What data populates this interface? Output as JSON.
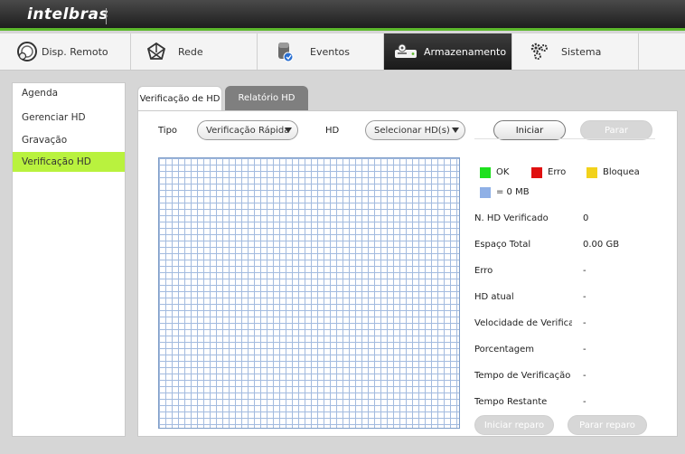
{
  "app": {
    "logo": "intelbras"
  },
  "main_tabs": [
    {
      "label": "Disp. Remoto",
      "icon": "remote-device-icon"
    },
    {
      "label": "Rede",
      "icon": "network-icon"
    },
    {
      "label": "Eventos",
      "icon": "events-icon"
    },
    {
      "label": "Armazenamento",
      "icon": "storage-icon",
      "active": true
    },
    {
      "label": "Sistema",
      "icon": "system-gears-icon"
    }
  ],
  "sidebar": {
    "items": [
      {
        "label": "Agenda"
      },
      {
        "label": "Gerenciar HD"
      },
      {
        "label": "Gravação"
      },
      {
        "label": "Verificação HD",
        "active": true
      }
    ]
  },
  "subtabs": [
    {
      "label": "Verificação de HD",
      "active": true
    },
    {
      "label": "Relatório HD"
    }
  ],
  "form": {
    "tipo_label": "Tipo",
    "tipo_value": "Verificação Rápida",
    "hd_label": "HD",
    "hd_value": "Selecionar HD(s)",
    "start_label": "Iniciar",
    "stop_label": "Parar"
  },
  "legend": {
    "ok": "OK",
    "error": "Erro",
    "blocked": "Bloquea",
    "size": "= 0 MB"
  },
  "colors": {
    "ok": "#1ee01e",
    "error": "#e01010",
    "blocked": "#f2d21b",
    "size": "#8fb0e6",
    "accent": "#b9f23e"
  },
  "info": [
    {
      "label": "N. HD Verificado",
      "value": "0"
    },
    {
      "label": "Espaço Total",
      "value": "0.00 GB"
    },
    {
      "label": "Erro",
      "value": "-"
    },
    {
      "label": "HD atual",
      "value": "-"
    },
    {
      "label": "Velocidade de Verificação",
      "value": "-"
    },
    {
      "label": "Porcentagem",
      "value": "-"
    },
    {
      "label": "Tempo de Verificação",
      "value": "-"
    },
    {
      "label": "Tempo Restante",
      "value": "-"
    }
  ],
  "repair": {
    "start_label": "Iniciar reparo",
    "stop_label": "Parar reparo"
  }
}
